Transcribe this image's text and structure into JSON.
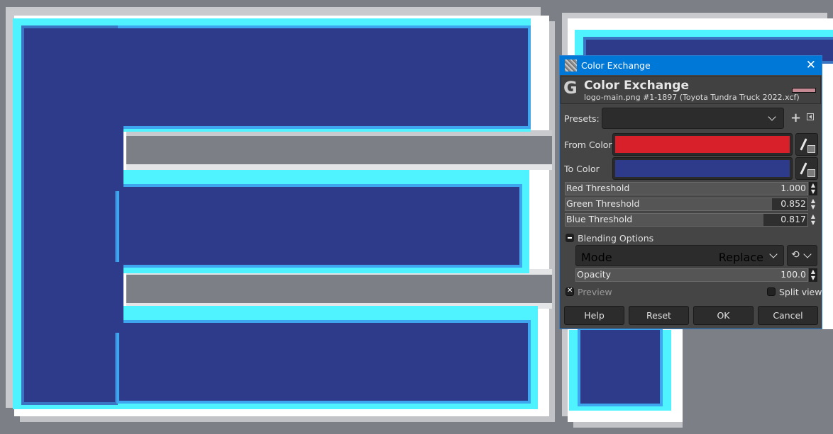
{
  "canvas": {
    "description": "Zoomed image canvas showing part of a blue letter logo with cyan/white outline",
    "colors": {
      "background": "#7c7f86",
      "fill": "#2e3b8b",
      "outline_inner": "#3ea6ef",
      "outline_cyan": "#4ff3ff",
      "halo": "#ffffff"
    }
  },
  "dialog": {
    "window_title": "Color Exchange",
    "close_icon": "close-icon",
    "header": {
      "title": "Color Exchange",
      "subtitle": "logo-main.png #1-1897 (Toyota Tundra Truck 2022.xcf)",
      "logo": "G"
    },
    "presets": {
      "label": "Presets:",
      "value": "",
      "add_icon": "plus-icon",
      "menu_icon": "triangle-left-icon"
    },
    "from_color": {
      "label": "From Color",
      "color": "#d7202a"
    },
    "to_color": {
      "label": "To Color",
      "color": "#2e3b8b"
    },
    "thresholds": [
      {
        "label": "Red Threshold",
        "value": "1.000",
        "fraction": 1.0
      },
      {
        "label": "Green Threshold",
        "value": "0.852",
        "fraction": 0.852
      },
      {
        "label": "Blue Threshold",
        "value": "0.817",
        "fraction": 0.817
      }
    ],
    "blending": {
      "section_label": "Blending Options",
      "mode_label": "Mode",
      "mode_value": "Replace",
      "opacity_label": "Opacity",
      "opacity_value": "100.0",
      "opacity_fraction": 1.0
    },
    "preview": {
      "label": "Preview",
      "checked": true
    },
    "split_view": {
      "label": "Split view",
      "checked": false
    },
    "buttons": {
      "help": "Help",
      "reset": "Reset",
      "ok": "OK",
      "cancel": "Cancel"
    }
  }
}
